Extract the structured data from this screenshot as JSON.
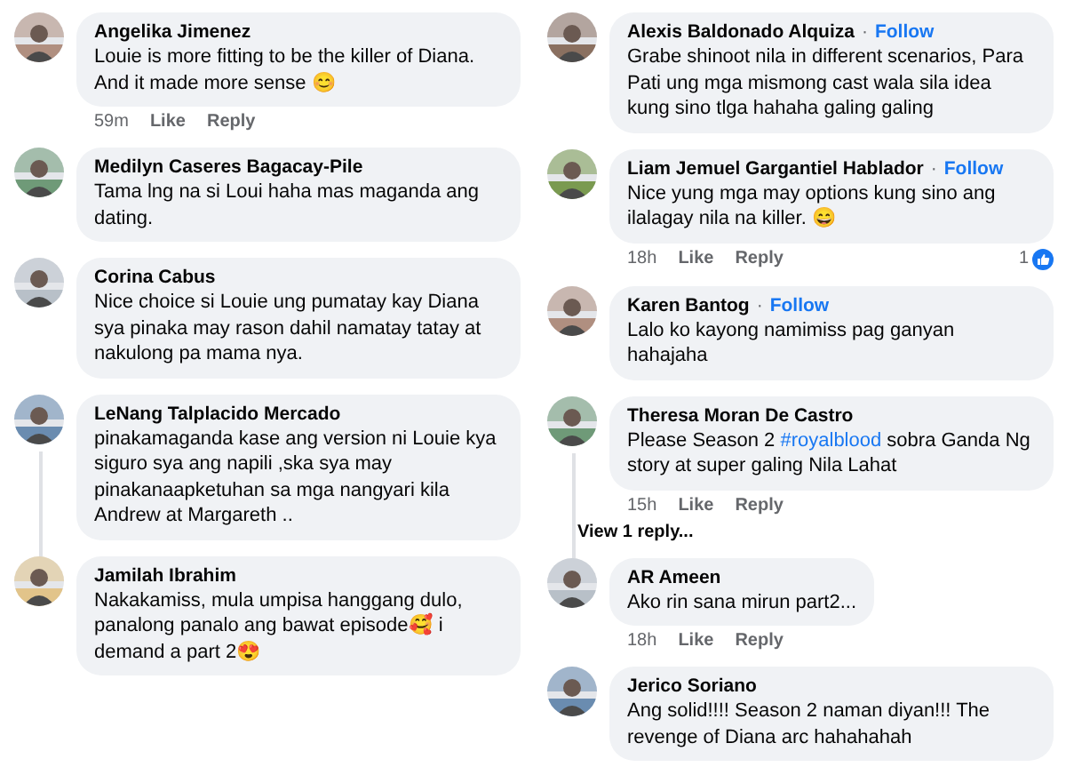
{
  "columns": [
    {
      "comments": [
        {
          "author": "Angelika Jimenez",
          "segments": [
            {
              "kind": "plain",
              "text": "Louie is more fitting to be the killer of Diana. And it made more sense 😊"
            }
          ],
          "meta": {
            "time": "59m",
            "like": "Like",
            "reply": "Reply"
          },
          "thread_line": false,
          "avatar": {
            "kind": "picture"
          }
        },
        {
          "author": "Medilyn Caseres Bagacay-Pile",
          "segments": [
            {
              "kind": "plain",
              "text": "Tama lng na si Loui haha mas maganda ang dating."
            }
          ],
          "thread_line": false,
          "avatar": {
            "kind": "picture"
          }
        },
        {
          "author": "Corina Cabus",
          "segments": [
            {
              "kind": "plain",
              "text": "Nice choice si Louie ung pumatay kay Diana sya pinaka may rason dahil namatay tatay at nakulong pa mama nya."
            }
          ],
          "thread_line": false,
          "avatar": {
            "kind": "picture"
          }
        },
        {
          "author": "LeNang Talplacido Mercado",
          "segments": [
            {
              "kind": "plain",
              "text": "pinakamaganda kase ang version ni Louie kya siguro sya ang napili ,ska sya may pinakanaapketuhan sa mga nangyari kila Andrew at Margareth .."
            }
          ],
          "thread_line": true,
          "avatar": {
            "kind": "picture"
          }
        },
        {
          "author": "Jamilah Ibrahim",
          "segments": [
            {
              "kind": "plain",
              "text": "Nakakamiss, mula umpisa hanggang dulo, panalong panalo ang bawat episode🥰 i demand a part 2😍"
            }
          ],
          "thread_line": false,
          "avatar": {
            "kind": "picture"
          }
        }
      ]
    },
    {
      "comments": [
        {
          "author": "Alexis Baldonado Alquiza",
          "separator": "·",
          "follow": "Follow",
          "segments": [
            {
              "kind": "plain",
              "text": "Grabe shinoot nila in different scenarios, Para Pati ung mga mismong cast wala sila idea kung sino tlga hahaha galing galing"
            }
          ],
          "thread_line": false,
          "avatar": {
            "kind": "picture"
          }
        },
        {
          "author": "Liam Jemuel Gargantiel Hablador",
          "separator": "·",
          "follow": "Follow",
          "segments": [
            {
              "kind": "plain",
              "text": "Nice yung mga may options kung sino ang ilalagay nila na killer. 😄"
            }
          ],
          "meta": {
            "time": "18h",
            "like": "Like",
            "reply": "Reply",
            "reactions": "1"
          },
          "thread_line": false,
          "avatar": {
            "kind": "picture"
          }
        },
        {
          "author": "Karen Bantog",
          "separator": "·",
          "follow": "Follow",
          "segments": [
            {
              "kind": "plain",
              "text": "Lalo ko kayong namimiss pag ganyan hahajaha"
            }
          ],
          "thread_line": false,
          "avatar": {
            "kind": "picture"
          }
        },
        {
          "author": "Theresa Moran De Castro",
          "segments": [
            {
              "kind": "plain",
              "text": "Please Season 2 "
            },
            {
              "kind": "hashtag",
              "text": "#royalblood"
            },
            {
              "kind": "plain",
              "text": " sobra Ganda Ng story at super galing Nila Lahat"
            }
          ],
          "meta": {
            "time": "15h",
            "like": "Like",
            "reply": "Reply"
          },
          "thread_line": true,
          "view_replies": "View 1 reply...",
          "avatar": {
            "kind": "picture"
          }
        },
        {
          "author": "AR Ameen",
          "segments": [
            {
              "kind": "plain",
              "text": "Ako rin sana mirun part2..."
            }
          ],
          "meta": {
            "time": "18h",
            "like": "Like",
            "reply": "Reply"
          },
          "thread_line": false,
          "avatar": {
            "kind": "picture"
          }
        },
        {
          "author": "Jerico Soriano",
          "segments": [
            {
              "kind": "plain",
              "text": "Ang solid!!!! Season 2 naman diyan!!! The revenge of Diana arc hahahahah"
            }
          ],
          "thread_line": false,
          "avatar": {
            "kind": "picture"
          }
        }
      ]
    }
  ]
}
